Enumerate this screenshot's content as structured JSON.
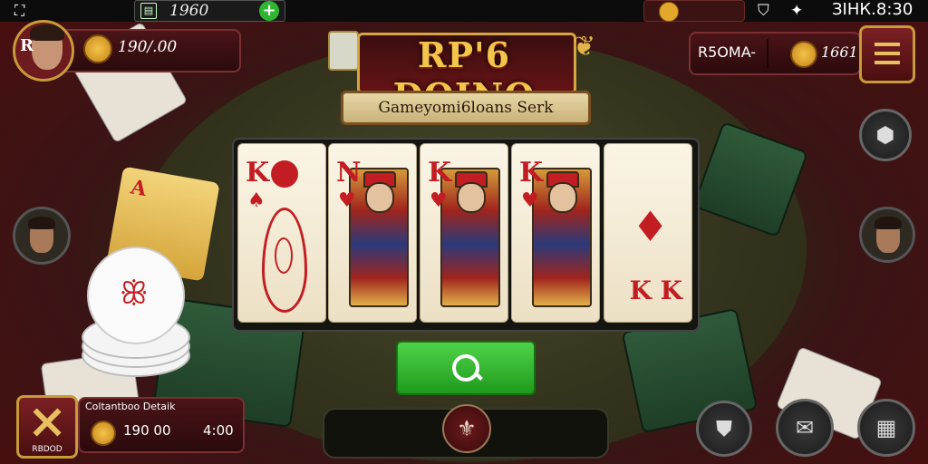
{
  "status_bar": {
    "app_icon": "dice-icon",
    "chip_value": "1960",
    "time": "ЗІНК.8:30"
  },
  "player": {
    "avatar_letter": "R",
    "coins": "190/.00"
  },
  "title": {
    "main": "RP'6 DOINO",
    "subtitle": "Gameyomi6loans Serk"
  },
  "room": {
    "label": "R5OMA-",
    "coins": "1661"
  },
  "cards": [
    {
      "rank": "K",
      "suit": "♠",
      "type": "pip"
    },
    {
      "rank": "N",
      "suit": "♥",
      "type": "face"
    },
    {
      "rank": "K",
      "suit": "♥",
      "type": "face"
    },
    {
      "rank": "K",
      "suit": "♥",
      "type": "face"
    },
    {
      "rank": "",
      "suit": "♦",
      "type": "back-pip",
      "corner": "K K"
    }
  ],
  "bottom_left": {
    "tools_label": "RBDOD",
    "panel_header": "Coltantboo Detaik",
    "amount": "190 00",
    "time": "4:00"
  },
  "colors": {
    "accent_gold": "#d8a640",
    "felt": "#34341e",
    "panel_red": "#4a1417",
    "green_button": "#2fb52f"
  },
  "icons": {
    "search": "search-icon",
    "menu": "menu-icon",
    "shield": "shield-icon",
    "tools": "crossed-tools-icon"
  }
}
